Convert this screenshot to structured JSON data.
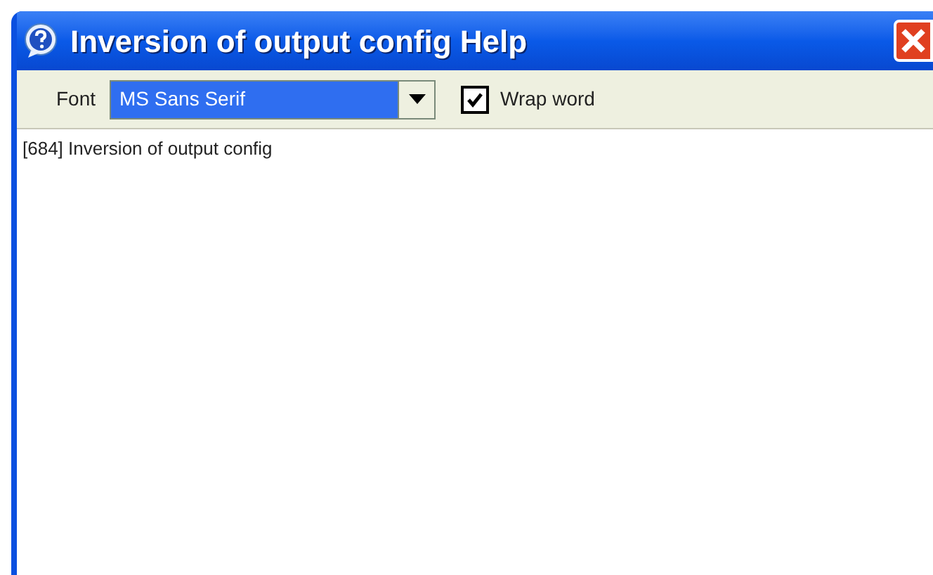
{
  "window": {
    "title": "Inversion of output config Help"
  },
  "toolbar": {
    "font_label": "Font",
    "font_value": "MS Sans Serif",
    "wrap_word": {
      "label": "Wrap word",
      "checked": true
    }
  },
  "content": {
    "text": "[684] Inversion of output config"
  }
}
